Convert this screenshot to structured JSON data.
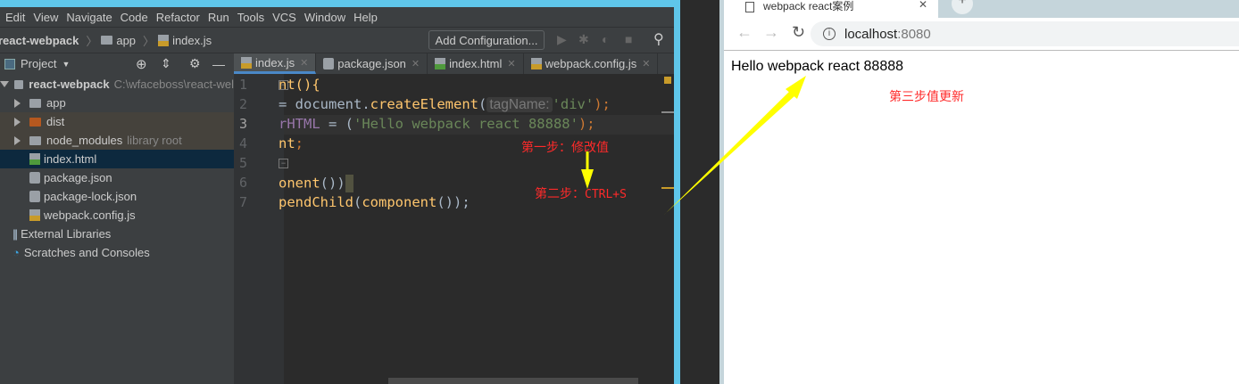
{
  "ide": {
    "menu": [
      "Edit",
      "View",
      "Navigate",
      "Code",
      "Refactor",
      "Run",
      "Tools",
      "VCS",
      "Window",
      "Help"
    ],
    "breadcrumb": [
      "react-webpack",
      "app",
      "index.js"
    ],
    "add_configuration": "Add Configuration...",
    "project_label": "Project",
    "tree": [
      {
        "label": "react-webpack",
        "extra": "C:\\wfaceboss\\react-wel",
        "type": "folder"
      },
      {
        "label": "app",
        "type": "folder"
      },
      {
        "label": "dist",
        "type": "folder-excluded"
      },
      {
        "label": "node_modules",
        "extra": "library root",
        "type": "folder"
      },
      {
        "label": "index.html",
        "type": "html",
        "selected": true
      },
      {
        "label": "package.json",
        "type": "json"
      },
      {
        "label": "package-lock.json",
        "type": "json"
      },
      {
        "label": "webpack.config.js",
        "type": "js"
      },
      {
        "label": "External Libraries",
        "type": "libraries"
      },
      {
        "label": "Scratches and Consoles",
        "type": "scratches"
      }
    ],
    "tabs": [
      {
        "label": "index.js",
        "active": true
      },
      {
        "label": "package.json"
      },
      {
        "label": "index.html"
      },
      {
        "label": "webpack.config.js"
      }
    ],
    "line_numbers": [
      "1",
      "2",
      "3",
      "4",
      "5",
      "6",
      "7"
    ],
    "code": {
      "l1a": "nt(){",
      "l2a": "= ",
      "l2b": "document.",
      "l2c": "createElement",
      "l2d": "(",
      "l2hint": "tagName:",
      "l2e": "'div'",
      "l2f": ");",
      "l3a": "rHTML",
      "l3b": " = (",
      "l3c": "'Hello webpack react 88888'",
      "l3d": ");",
      "l4a": "nt",
      ";": ";",
      "l6a": "onent",
      "l6b": "())",
      "l7a": "pendChild",
      "l7b": "(",
      "l7c": "component",
      "l7d": "());"
    },
    "annotations": {
      "step1": "第一步：修改值",
      "step2_prefix": "第二步：",
      "step2_key": "CTRL+S"
    }
  },
  "browser": {
    "tab_title": "webpack react案例",
    "url_host": "localhost",
    "url_port": ":8080",
    "content": "Hello webpack react 88888",
    "annotation": "第三步值更新"
  },
  "colors": {
    "annotation": "#ff2a2a",
    "arrow": "#ffff00",
    "accent": "#4a88c7"
  }
}
